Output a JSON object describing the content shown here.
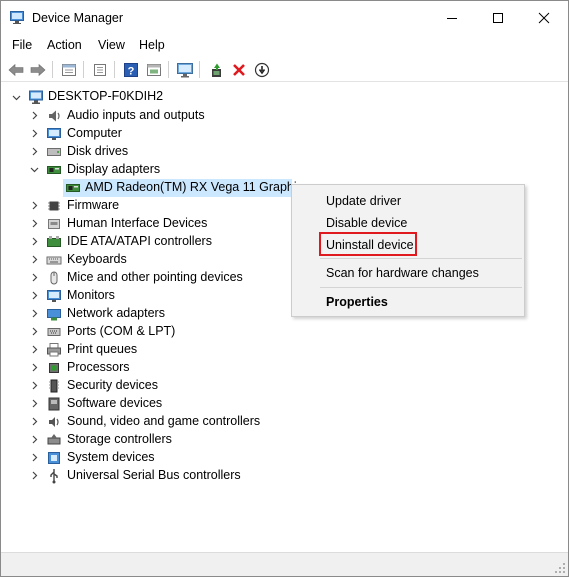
{
  "window": {
    "title": "Device Manager",
    "minimize_glyph": "—",
    "maximize_glyph": "☐",
    "close_glyph": "✕"
  },
  "menu": [
    "File",
    "Action",
    "View",
    "Help"
  ],
  "toolbar": {
    "buttons": [
      "back-icon",
      "forward-icon",
      "properties-sheet-icon",
      "show-hidden-icon",
      "help-icon",
      "resource-view-icon",
      "scan-monitor-icon",
      "update-driver-icon",
      "uninstall-x-icon",
      "disable-device-icon"
    ]
  },
  "tree": {
    "root": "DESKTOP-F0KDIH2",
    "categories": [
      "Audio inputs and outputs",
      "Computer",
      "Disk drives",
      "Display adapters",
      "Firmware",
      "Human Interface Devices",
      "IDE ATA/ATAPI controllers",
      "Keyboards",
      "Mice and other pointing devices",
      "Monitors",
      "Network adapters",
      "Ports (COM & LPT)",
      "Print queues",
      "Processors",
      "Security devices",
      "Software devices",
      "Sound, video and game controllers",
      "Storage controllers",
      "System devices",
      "Universal Serial Bus controllers"
    ],
    "display_child": "AMD Radeon(TM) RX Vega 11 Graphics"
  },
  "context_menu": {
    "update": "Update driver",
    "disable": "Disable device",
    "uninstall": "Uninstall device",
    "scan": "Scan for hardware changes",
    "properties": "Properties"
  },
  "colors": {
    "selection": "#cce8ff",
    "highlight_border": "#e0191f",
    "uninstall_x": "#e0191f",
    "update_green": "#2e9c2e"
  }
}
